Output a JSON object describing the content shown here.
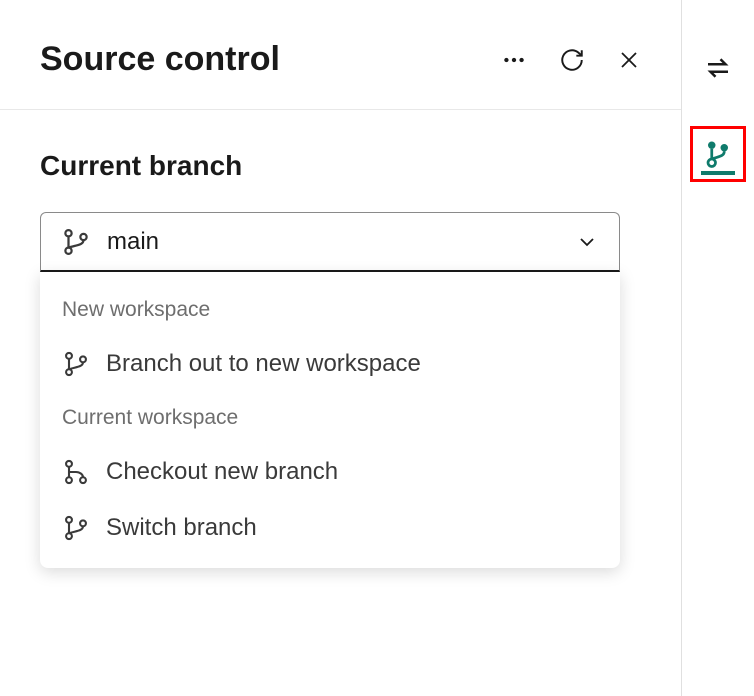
{
  "header": {
    "title": "Source control"
  },
  "branch": {
    "label": "Current branch",
    "value": "main"
  },
  "menu": {
    "group1_label": "New workspace",
    "item1": "Branch out to new workspace",
    "group2_label": "Current workspace",
    "item2": "Checkout new branch",
    "item3": "Switch branch"
  },
  "colors": {
    "accent": "#0f7b6c",
    "highlight": "#ff0000"
  }
}
